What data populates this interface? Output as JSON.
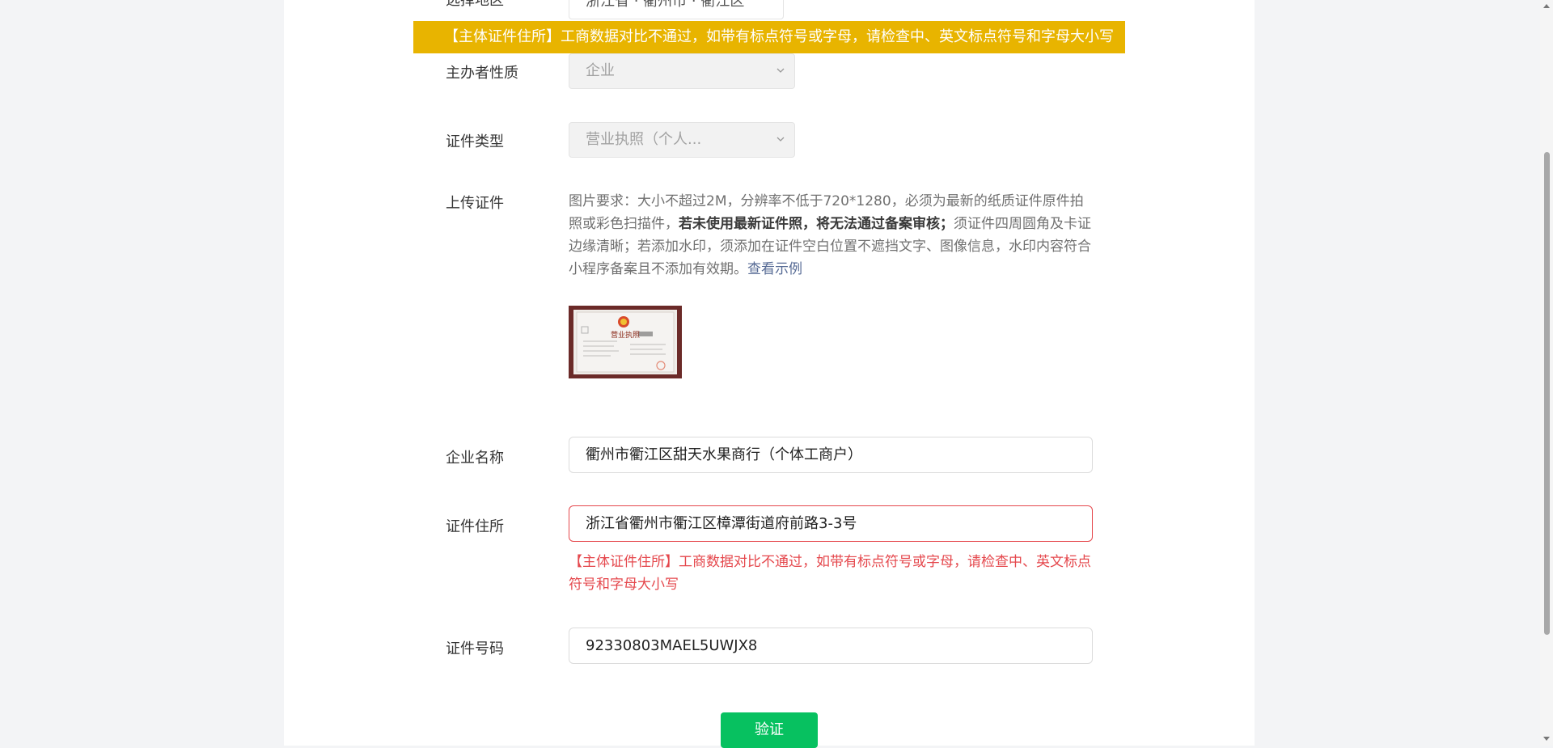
{
  "banner": {
    "message": "【主体证件住所】工商数据对比不通过，如带有标点符号或字母，请检查中、英文标点符号和字母大小写"
  },
  "form": {
    "region": {
      "label": "选择地区",
      "value": "浙江省 · 衢州市 · 衢江区"
    },
    "organizer_type": {
      "label": "主办者性质",
      "value": "企业"
    },
    "cert_type": {
      "label": "证件类型",
      "value": "营业执照（个人..."
    },
    "upload": {
      "label": "上传证件",
      "help_part1": "图片要求：大小不超过2M，分辨率不低于720*1280，必须为最新的纸质证件原件拍照或彩色扫描件，",
      "help_bold": "若未使用最新证件照，将无法通过备案审核；",
      "help_part2": "须证件四周圆角及卡证边缘清晰；若添加水印，须添加在证件空白位置不遮挡文字、图像信息，水印内容符合小程序备案且不添加有效期。",
      "example_link": "查看示例",
      "thumb_text": "营业执照"
    },
    "company_name": {
      "label": "企业名称",
      "value": "衢州市衢江区甜天水果商行（个体工商户）"
    },
    "cert_address": {
      "label": "证件住所",
      "value": "浙江省衢州市衢江区樟潭街道府前路3-3号",
      "error": "【主体证件住所】工商数据对比不通过，如带有标点符号或字母，请检查中、英文标点符号和字母大小写"
    },
    "cert_number": {
      "label": "证件号码",
      "value": "92330803MAEL5UWJX8"
    },
    "submit_label": "验证"
  },
  "colors": {
    "banner": "#e8b400",
    "primary": "#07c160",
    "error": "#e5484d",
    "link": "#576b95"
  },
  "icons": [
    "chevron-down-icon",
    "scroll-up-icon",
    "scroll-down-icon"
  ]
}
